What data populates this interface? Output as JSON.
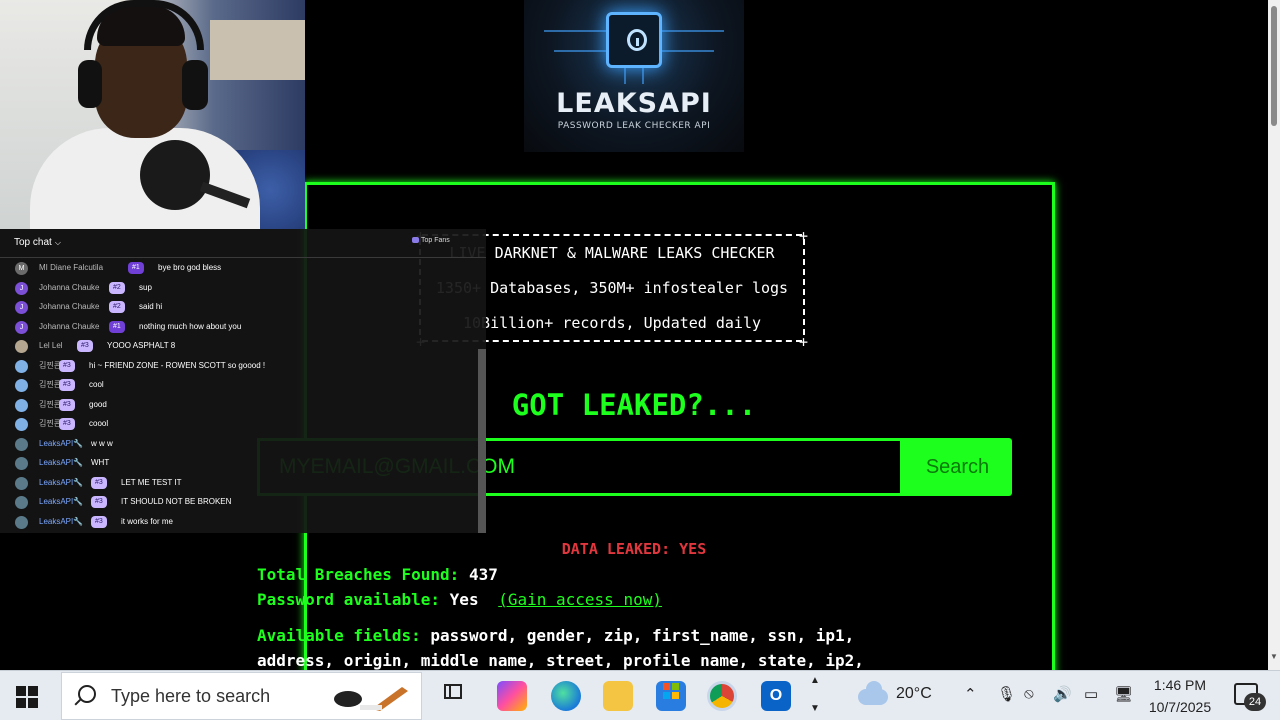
{
  "logo": {
    "name": "LEAKSAPI",
    "tagline": "PASSWORD LEAK CHECKER API"
  },
  "ascii_box": {
    "line1": "LIVE DARKNET & MALWARE LEAKS CHECKER",
    "line2": "1350+ Databases, 350M+ infostealer logs",
    "line3": "10Billion+ records, Updated daily"
  },
  "headline": "GOT LEAKED?...",
  "search": {
    "value": "MYEMAIL@GMAIL.COM",
    "button_label": "Search"
  },
  "result": {
    "leaked_label": "DATA LEAKED: YES",
    "breaches_label": "Total Breaches Found:",
    "breaches_value": "437",
    "password_label": "Password available:",
    "password_value": "Yes",
    "gain_access_link": "(Gain access now)",
    "fields_label": "Available fields:",
    "fields_line1": "password, gender, zip, first_name, ssn, ip1,",
    "fields_line2": "address, origin, middle name, street, profile name, state, ip2,"
  },
  "chat": {
    "header": "Top chat",
    "top_fans": "Top Fans",
    "messages": [
      {
        "initial": "M",
        "user": "MI Diane Falcutila",
        "badge": "#1",
        "text": "bye bro god bless",
        "avatar_color": "#6b6b6b"
      },
      {
        "initial": "J",
        "user": "Johanna Chauke",
        "badge": "#2",
        "text": "sup",
        "avatar_color": "#7b4fd6"
      },
      {
        "initial": "J",
        "user": "Johanna Chauke",
        "badge": "#2",
        "text": "said hi",
        "avatar_color": "#7b4fd6"
      },
      {
        "initial": "J",
        "user": "Johanna Chauke",
        "badge": "#1",
        "text": "nothing much how about you",
        "avatar_color": "#7b4fd6"
      },
      {
        "initial": "",
        "user": "Lel Lel",
        "badge": "#3",
        "text": "YOOO ASPHALT 8",
        "avatar_color": "#b5a690"
      },
      {
        "initial": "",
        "user": "김찐쿈",
        "badge": "#3",
        "text": "hi ~ FRIEND ZONE - ROWEN SCOTT so goood !",
        "avatar_color": "#7fb0e6"
      },
      {
        "initial": "",
        "user": "김찐쿈",
        "badge": "#3",
        "text": "cool",
        "avatar_color": "#7fb0e6"
      },
      {
        "initial": "",
        "user": "김찐쿈",
        "badge": "#3",
        "text": "good",
        "avatar_color": "#7fb0e6"
      },
      {
        "initial": "",
        "user": "김찐쿈",
        "badge": "#3",
        "text": "coool",
        "avatar_color": "#7fb0e6"
      },
      {
        "initial": "",
        "user": "LeaksAPI🔧",
        "badge": "",
        "text": "w w w",
        "avatar_color": "#5a7a8a"
      },
      {
        "initial": "",
        "user": "LeaksAPI🔧",
        "badge": "",
        "text": "WHT",
        "avatar_color": "#5a7a8a"
      },
      {
        "initial": "",
        "user": "LeaksAPI🔧",
        "badge": "#3",
        "text": "LET ME TEST IT",
        "avatar_color": "#5a7a8a"
      },
      {
        "initial": "",
        "user": "LeaksAPI🔧",
        "badge": "#3",
        "text": "IT SHOULD NOT BE BROKEN",
        "avatar_color": "#5a7a8a"
      },
      {
        "initial": "",
        "user": "LeaksAPI🔧",
        "badge": "#3",
        "text": "it works for me",
        "avatar_color": "#5a7a8a"
      }
    ]
  },
  "taskbar": {
    "search_placeholder": "Type here to search",
    "weather_temp": "20°C",
    "time": "1:46 PM",
    "date": "10/7/2025",
    "notification_count": "24"
  }
}
